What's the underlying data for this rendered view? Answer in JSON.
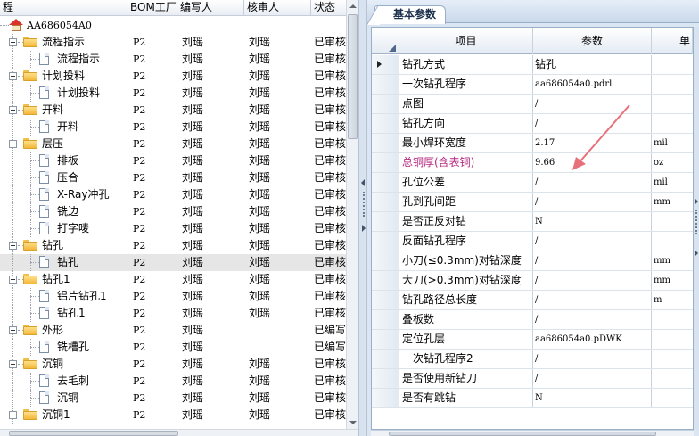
{
  "left_header": {
    "col0": "程",
    "col_bom": "BOM工厂",
    "col_writer": "编写人",
    "col_reviewer": "核审人",
    "col_status": "状态"
  },
  "tree": {
    "root_label": "AA686054A0",
    "rows": [
      {
        "label": "",
        "bom": "",
        "writer": "",
        "reviewer": "",
        "status": ""
      },
      {
        "label": "流程指示",
        "bom": "P2",
        "writer": "刘瑶",
        "reviewer": "刘瑶",
        "status": "已审核"
      },
      {
        "label": "流程指示",
        "bom": "P2",
        "writer": "刘瑶",
        "reviewer": "刘瑶",
        "status": "已审核"
      },
      {
        "label": "计划投料",
        "bom": "P2",
        "writer": "刘瑶",
        "reviewer": "刘瑶",
        "status": "已审核"
      },
      {
        "label": "计划投料",
        "bom": "P2",
        "writer": "刘瑶",
        "reviewer": "刘瑶",
        "status": "已审核"
      },
      {
        "label": "开料",
        "bom": "P2",
        "writer": "刘瑶",
        "reviewer": "刘瑶",
        "status": "已审核"
      },
      {
        "label": "开料",
        "bom": "P2",
        "writer": "刘瑶",
        "reviewer": "刘瑶",
        "status": "已审核"
      },
      {
        "label": "层压",
        "bom": "P2",
        "writer": "刘瑶",
        "reviewer": "刘瑶",
        "status": "已审核"
      },
      {
        "label": "排板",
        "bom": "P2",
        "writer": "刘瑶",
        "reviewer": "刘瑶",
        "status": "已审核"
      },
      {
        "label": "压合",
        "bom": "P2",
        "writer": "刘瑶",
        "reviewer": "刘瑶",
        "status": "已审核"
      },
      {
        "label": "X-Ray冲孔",
        "bom": "P2",
        "writer": "刘瑶",
        "reviewer": "刘瑶",
        "status": "已审核"
      },
      {
        "label": "铣边",
        "bom": "P2",
        "writer": "刘瑶",
        "reviewer": "刘瑶",
        "status": "已审核"
      },
      {
        "label": "打字唛",
        "bom": "P2",
        "writer": "刘瑶",
        "reviewer": "刘瑶",
        "status": "已审核"
      },
      {
        "label": "钻孔",
        "bom": "P2",
        "writer": "刘瑶",
        "reviewer": "刘瑶",
        "status": "已审核"
      },
      {
        "label": "钻孔",
        "bom": "P2",
        "writer": "刘瑶",
        "reviewer": "刘瑶",
        "status": "已审核"
      },
      {
        "label": "钻孔1",
        "bom": "P2",
        "writer": "刘瑶",
        "reviewer": "刘瑶",
        "status": "已审核"
      },
      {
        "label": "铝片钻孔1",
        "bom": "P2",
        "writer": "刘瑶",
        "reviewer": "刘瑶",
        "status": "已审核"
      },
      {
        "label": "钻孔1",
        "bom": "P2",
        "writer": "刘瑶",
        "reviewer": "刘瑶",
        "status": "已审核"
      },
      {
        "label": "外形",
        "bom": "P2",
        "writer": "刘瑶",
        "reviewer": "",
        "status": "已编写"
      },
      {
        "label": "铣槽孔",
        "bom": "P2",
        "writer": "刘瑶",
        "reviewer": "",
        "status": "已编写"
      },
      {
        "label": "沉铜",
        "bom": "P2",
        "writer": "刘瑶",
        "reviewer": "刘瑶",
        "status": "已审核"
      },
      {
        "label": "去毛刺",
        "bom": "P2",
        "writer": "刘瑶",
        "reviewer": "刘瑶",
        "status": "已审核"
      },
      {
        "label": "沉铜",
        "bom": "P2",
        "writer": "刘瑶",
        "reviewer": "刘瑶",
        "status": "已审核"
      },
      {
        "label": "沉铜1",
        "bom": "P2",
        "writer": "刘瑶",
        "reviewer": "刘瑶",
        "status": "已审核"
      }
    ]
  },
  "right_panel": {
    "tab_label": "基本参数",
    "header": {
      "key": "项目",
      "value": "参数",
      "unit": "单"
    },
    "rows": [
      {
        "key": "钻孔方式",
        "value": "钻孔",
        "unit": ""
      },
      {
        "key": "一次钻孔程序",
        "value": "aa686054a0.pdrl",
        "unit": ""
      },
      {
        "key": "点图",
        "value": "/",
        "unit": ""
      },
      {
        "key": "钻孔方向",
        "value": "/",
        "unit": ""
      },
      {
        "key": "最小焊环宽度",
        "value": "2.17",
        "unit": "mil"
      },
      {
        "key": "总铜厚(含表铜)",
        "value": "9.66",
        "unit": "oz"
      },
      {
        "key": "孔位公差",
        "value": "/",
        "unit": "mil"
      },
      {
        "key": "孔到孔间距",
        "value": "/",
        "unit": "mm"
      },
      {
        "key": "是否正反对钻",
        "value": "N",
        "unit": ""
      },
      {
        "key": "反面钻孔程序",
        "value": "/",
        "unit": ""
      },
      {
        "key": "小刀(≤0.3mm)对钻深度",
        "value": "/",
        "unit": "mm"
      },
      {
        "key": "大刀(>0.3mm)对钻深度",
        "value": "/",
        "unit": "mm"
      },
      {
        "key": "钻孔路径总长度",
        "value": "/",
        "unit": "m"
      },
      {
        "key": "叠板数",
        "value": "/",
        "unit": ""
      },
      {
        "key": "定位孔层",
        "value": "aa686054a0.pDWK",
        "unit": ""
      },
      {
        "key": "一次钻孔程序2",
        "value": "/",
        "unit": ""
      },
      {
        "key": "是否使用新钻刀",
        "value": "/",
        "unit": ""
      },
      {
        "key": "是否有跳钻",
        "value": "N",
        "unit": ""
      }
    ]
  },
  "colors": {
    "highlight_label": "#b5287f",
    "annotation_arrow": "#e8707a",
    "folder": "#f3b83a"
  }
}
